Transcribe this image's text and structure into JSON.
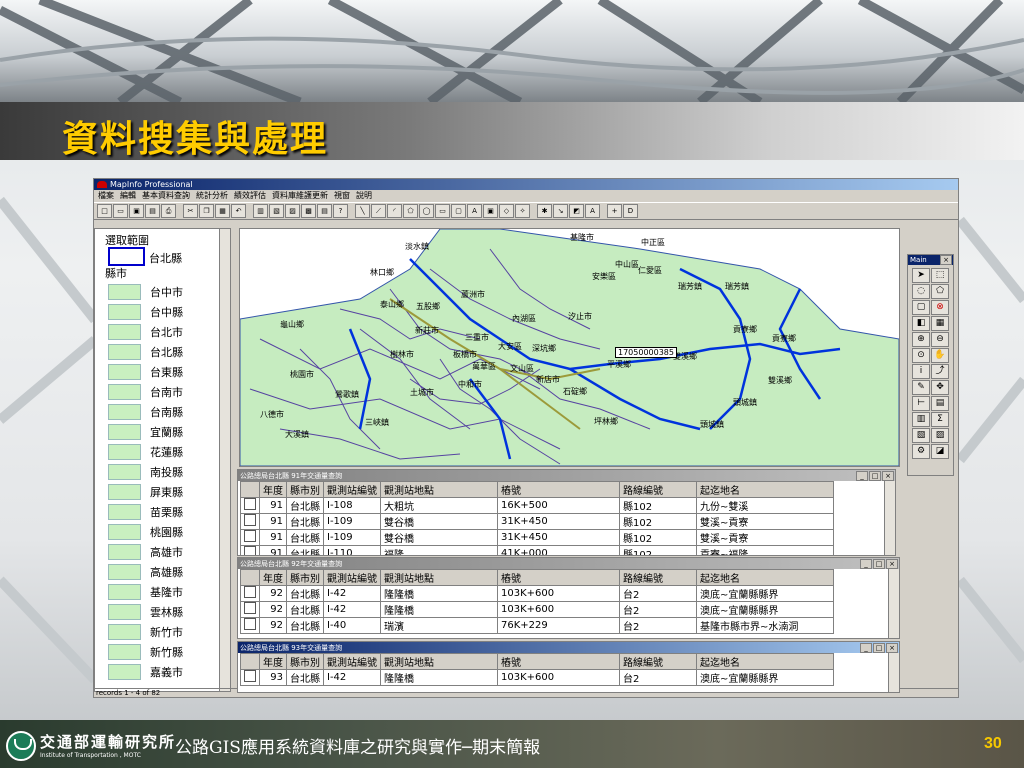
{
  "slide": {
    "title": "資料搜集與處理",
    "footer_title": "公路GIS應用系統資料庫之研究與實作─期末簡報",
    "page_number": "30",
    "org_name": "交通部運輸研究所",
    "org_en": "Institute of Transportation , MOTC"
  },
  "app": {
    "title": "MapInfo Professional",
    "menu": [
      "檔案",
      "編輯",
      "基本資料查詢",
      "統計分析",
      "績效評估",
      "資料庫維護更新",
      "視窗",
      "說明"
    ],
    "status": "records 1 - 4 of 82"
  },
  "legend": {
    "header": "選取範圍",
    "selection_label": "台北縣",
    "group_header": "縣市",
    "items": [
      "台中市",
      "台中縣",
      "台北市",
      "台北縣",
      "台東縣",
      "台南市",
      "台南縣",
      "宜蘭縣",
      "花蓮縣",
      "南投縣",
      "屏東縣",
      "苗栗縣",
      "桃園縣",
      "高雄市",
      "高雄縣",
      "基隆市",
      "雲林縣",
      "新竹市",
      "新竹縣",
      "嘉義市"
    ]
  },
  "map": {
    "labels": [
      "淡水鎮",
      "基隆市",
      "中正區",
      "中山區",
      "仁愛區",
      "安樂區",
      "瑞芳鎮",
      "瑞芳鎮",
      "貢寮鄉",
      "貢寮鄉",
      "雙溪鄉",
      "雙溪鄉",
      "頭城鎮",
      "頭城鎮",
      "平溪鄉",
      "石碇鄉",
      "坪林鄉",
      "新店市",
      "中和市",
      "板橋市",
      "土城市",
      "三峽鎮",
      "樹林市",
      "鶯歌鎮",
      "林口鄉",
      "五股鄉",
      "泰山鄉",
      "新莊市",
      "蘆洲市",
      "三重市",
      "汐止市",
      "深坑鄉",
      "內湖區",
      "大安區",
      "文山區",
      "萬華區",
      "龜山鄉",
      "桃園市",
      "八德市",
      "大溪鎮"
    ],
    "callout": "17050000385"
  },
  "palette": {
    "title": "Main"
  },
  "tables": [
    {
      "title": "公路總局台北縣 91年交通量查詢",
      "headers": [
        "年度",
        "縣市別",
        "觀測站編號",
        "觀測站地點",
        "樁號",
        "路線編號",
        "起迄地名"
      ],
      "rows": [
        [
          "91",
          "台北縣",
          "I-108",
          "大粗坑",
          "16K+500",
          "縣102",
          "九份~雙溪"
        ],
        [
          "91",
          "台北縣",
          "I-109",
          "雙谷橋",
          "31K+450",
          "縣102",
          "雙溪~貢寮"
        ],
        [
          "91",
          "台北縣",
          "I-109",
          "雙谷橋",
          "31K+450",
          "縣102",
          "雙溪~貢寮"
        ],
        [
          "91",
          "台北縣",
          "I-110",
          "福隆",
          "41K+000",
          "縣102",
          "貢寮~福隆"
        ]
      ]
    },
    {
      "title": "公路總局台北縣 92年交通量查詢",
      "headers": [
        "年度",
        "縣市別",
        "觀測站編號",
        "觀測站地點",
        "樁號",
        "路線編號",
        "起迄地名"
      ],
      "rows": [
        [
          "92",
          "台北縣",
          "I-42",
          "隆隆橋",
          "103K+600",
          "台2",
          "澳底~宜蘭縣縣界"
        ],
        [
          "92",
          "台北縣",
          "I-42",
          "隆隆橋",
          "103K+600",
          "台2",
          "澳底~宜蘭縣縣界"
        ],
        [
          "92",
          "台北縣",
          "I-40",
          "瑞濱",
          "76K+229",
          "台2",
          "基隆市縣市界~水湳洞"
        ]
      ]
    },
    {
      "title": "公路總局台北縣 93年交通量查詢",
      "headers": [
        "年度",
        "縣市別",
        "觀測站編號",
        "觀測站地點",
        "樁號",
        "路線編號",
        "起迄地名"
      ],
      "rows": [
        [
          "93",
          "台北縣",
          "I-42",
          "隆隆橋",
          "103K+600",
          "台2",
          "澳底~宜蘭縣縣界"
        ]
      ]
    }
  ]
}
